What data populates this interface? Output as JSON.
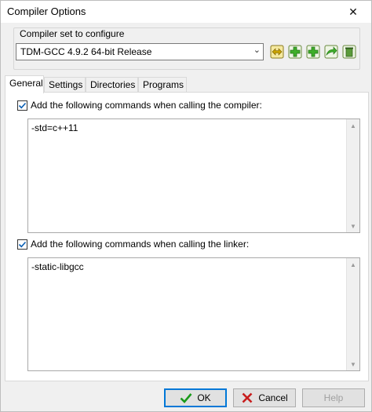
{
  "window": {
    "title": "Compiler Options",
    "close_glyph": "✕"
  },
  "compiler_set": {
    "group_label": "Compiler set to configure",
    "selected": "TDM-GCC 4.9.2 64-bit Release",
    "toolbar_icons": [
      "rename-icon",
      "add-empty-set-icon",
      "add-folder-set-icon",
      "find-compilers-icon",
      "delete-set-icon"
    ]
  },
  "tabs": [
    {
      "label": "General"
    },
    {
      "label": "Settings"
    },
    {
      "label": "Directories"
    },
    {
      "label": "Programs"
    }
  ],
  "general": {
    "compiler_check_label": "Add the following commands when calling the compiler:",
    "compiler_checked": true,
    "compiler_commands": "-std=c++11",
    "linker_check_label": "Add the following commands when calling the linker:",
    "linker_checked": true,
    "linker_commands": "-static-libgcc"
  },
  "footer": {
    "ok_label": "OK",
    "cancel_label": "Cancel",
    "help_label": "Help"
  },
  "colors": {
    "accent": "#0078d7",
    "ok_check": "#1a9a1a",
    "cancel_x": "#c81e1e"
  }
}
